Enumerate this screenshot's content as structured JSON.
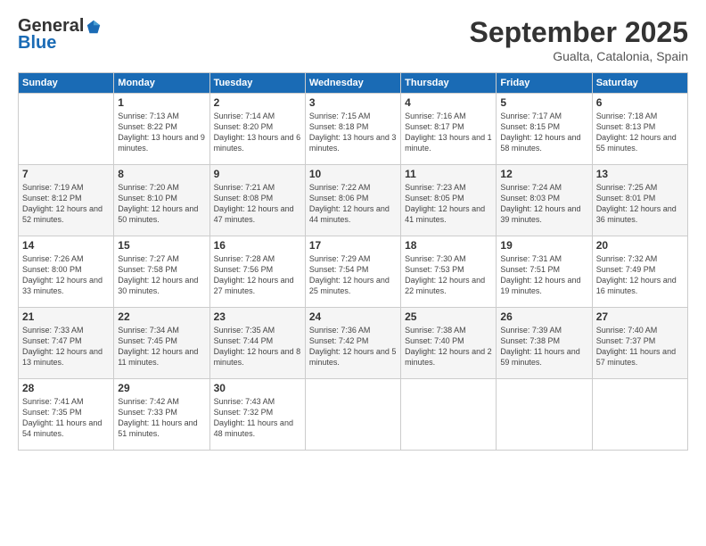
{
  "logo": {
    "general": "General",
    "blue": "Blue"
  },
  "header": {
    "title": "September 2025",
    "subtitle": "Gualta, Catalonia, Spain"
  },
  "days": [
    "Sunday",
    "Monday",
    "Tuesday",
    "Wednesday",
    "Thursday",
    "Friday",
    "Saturday"
  ],
  "weeks": [
    [
      {
        "day": "",
        "sunrise": "",
        "sunset": "",
        "daylight": ""
      },
      {
        "day": "1",
        "sunrise": "Sunrise: 7:13 AM",
        "sunset": "Sunset: 8:22 PM",
        "daylight": "Daylight: 13 hours and 9 minutes."
      },
      {
        "day": "2",
        "sunrise": "Sunrise: 7:14 AM",
        "sunset": "Sunset: 8:20 PM",
        "daylight": "Daylight: 13 hours and 6 minutes."
      },
      {
        "day": "3",
        "sunrise": "Sunrise: 7:15 AM",
        "sunset": "Sunset: 8:18 PM",
        "daylight": "Daylight: 13 hours and 3 minutes."
      },
      {
        "day": "4",
        "sunrise": "Sunrise: 7:16 AM",
        "sunset": "Sunset: 8:17 PM",
        "daylight": "Daylight: 13 hours and 1 minute."
      },
      {
        "day": "5",
        "sunrise": "Sunrise: 7:17 AM",
        "sunset": "Sunset: 8:15 PM",
        "daylight": "Daylight: 12 hours and 58 minutes."
      },
      {
        "day": "6",
        "sunrise": "Sunrise: 7:18 AM",
        "sunset": "Sunset: 8:13 PM",
        "daylight": "Daylight: 12 hours and 55 minutes."
      }
    ],
    [
      {
        "day": "7",
        "sunrise": "Sunrise: 7:19 AM",
        "sunset": "Sunset: 8:12 PM",
        "daylight": "Daylight: 12 hours and 52 minutes."
      },
      {
        "day": "8",
        "sunrise": "Sunrise: 7:20 AM",
        "sunset": "Sunset: 8:10 PM",
        "daylight": "Daylight: 12 hours and 50 minutes."
      },
      {
        "day": "9",
        "sunrise": "Sunrise: 7:21 AM",
        "sunset": "Sunset: 8:08 PM",
        "daylight": "Daylight: 12 hours and 47 minutes."
      },
      {
        "day": "10",
        "sunrise": "Sunrise: 7:22 AM",
        "sunset": "Sunset: 8:06 PM",
        "daylight": "Daylight: 12 hours and 44 minutes."
      },
      {
        "day": "11",
        "sunrise": "Sunrise: 7:23 AM",
        "sunset": "Sunset: 8:05 PM",
        "daylight": "Daylight: 12 hours and 41 minutes."
      },
      {
        "day": "12",
        "sunrise": "Sunrise: 7:24 AM",
        "sunset": "Sunset: 8:03 PM",
        "daylight": "Daylight: 12 hours and 39 minutes."
      },
      {
        "day": "13",
        "sunrise": "Sunrise: 7:25 AM",
        "sunset": "Sunset: 8:01 PM",
        "daylight": "Daylight: 12 hours and 36 minutes."
      }
    ],
    [
      {
        "day": "14",
        "sunrise": "Sunrise: 7:26 AM",
        "sunset": "Sunset: 8:00 PM",
        "daylight": "Daylight: 12 hours and 33 minutes."
      },
      {
        "day": "15",
        "sunrise": "Sunrise: 7:27 AM",
        "sunset": "Sunset: 7:58 PM",
        "daylight": "Daylight: 12 hours and 30 minutes."
      },
      {
        "day": "16",
        "sunrise": "Sunrise: 7:28 AM",
        "sunset": "Sunset: 7:56 PM",
        "daylight": "Daylight: 12 hours and 27 minutes."
      },
      {
        "day": "17",
        "sunrise": "Sunrise: 7:29 AM",
        "sunset": "Sunset: 7:54 PM",
        "daylight": "Daylight: 12 hours and 25 minutes."
      },
      {
        "day": "18",
        "sunrise": "Sunrise: 7:30 AM",
        "sunset": "Sunset: 7:53 PM",
        "daylight": "Daylight: 12 hours and 22 minutes."
      },
      {
        "day": "19",
        "sunrise": "Sunrise: 7:31 AM",
        "sunset": "Sunset: 7:51 PM",
        "daylight": "Daylight: 12 hours and 19 minutes."
      },
      {
        "day": "20",
        "sunrise": "Sunrise: 7:32 AM",
        "sunset": "Sunset: 7:49 PM",
        "daylight": "Daylight: 12 hours and 16 minutes."
      }
    ],
    [
      {
        "day": "21",
        "sunrise": "Sunrise: 7:33 AM",
        "sunset": "Sunset: 7:47 PM",
        "daylight": "Daylight: 12 hours and 13 minutes."
      },
      {
        "day": "22",
        "sunrise": "Sunrise: 7:34 AM",
        "sunset": "Sunset: 7:45 PM",
        "daylight": "Daylight: 12 hours and 11 minutes."
      },
      {
        "day": "23",
        "sunrise": "Sunrise: 7:35 AM",
        "sunset": "Sunset: 7:44 PM",
        "daylight": "Daylight: 12 hours and 8 minutes."
      },
      {
        "day": "24",
        "sunrise": "Sunrise: 7:36 AM",
        "sunset": "Sunset: 7:42 PM",
        "daylight": "Daylight: 12 hours and 5 minutes."
      },
      {
        "day": "25",
        "sunrise": "Sunrise: 7:38 AM",
        "sunset": "Sunset: 7:40 PM",
        "daylight": "Daylight: 12 hours and 2 minutes."
      },
      {
        "day": "26",
        "sunrise": "Sunrise: 7:39 AM",
        "sunset": "Sunset: 7:38 PM",
        "daylight": "Daylight: 11 hours and 59 minutes."
      },
      {
        "day": "27",
        "sunrise": "Sunrise: 7:40 AM",
        "sunset": "Sunset: 7:37 PM",
        "daylight": "Daylight: 11 hours and 57 minutes."
      }
    ],
    [
      {
        "day": "28",
        "sunrise": "Sunrise: 7:41 AM",
        "sunset": "Sunset: 7:35 PM",
        "daylight": "Daylight: 11 hours and 54 minutes."
      },
      {
        "day": "29",
        "sunrise": "Sunrise: 7:42 AM",
        "sunset": "Sunset: 7:33 PM",
        "daylight": "Daylight: 11 hours and 51 minutes."
      },
      {
        "day": "30",
        "sunrise": "Sunrise: 7:43 AM",
        "sunset": "Sunset: 7:32 PM",
        "daylight": "Daylight: 11 hours and 48 minutes."
      },
      {
        "day": "",
        "sunrise": "",
        "sunset": "",
        "daylight": ""
      },
      {
        "day": "",
        "sunrise": "",
        "sunset": "",
        "daylight": ""
      },
      {
        "day": "",
        "sunrise": "",
        "sunset": "",
        "daylight": ""
      },
      {
        "day": "",
        "sunrise": "",
        "sunset": "",
        "daylight": ""
      }
    ]
  ]
}
